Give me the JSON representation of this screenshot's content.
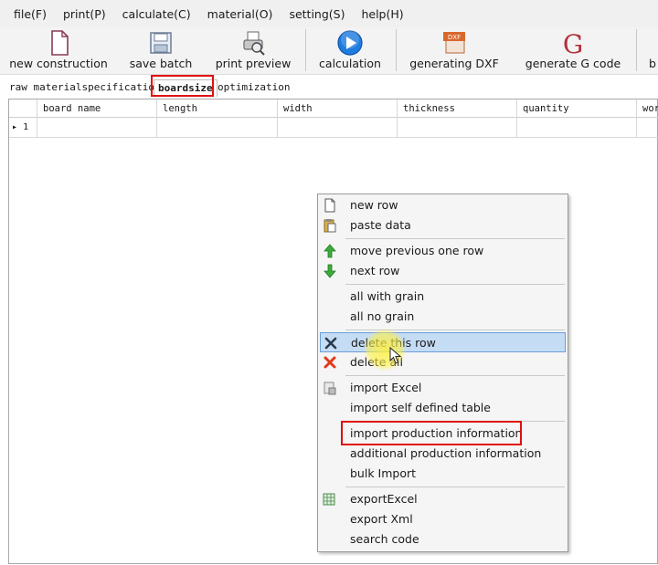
{
  "menubar": {
    "items": [
      {
        "label": "file(F)"
      },
      {
        "label": "print(P)"
      },
      {
        "label": "calculate(C)"
      },
      {
        "label": "material(O)"
      },
      {
        "label": "setting(S)"
      },
      {
        "label": "help(H)"
      }
    ]
  },
  "toolbar": {
    "items": [
      {
        "label": "new construction",
        "icon": "new-document-icon"
      },
      {
        "label": "save batch",
        "icon": "save-icon"
      },
      {
        "label": "print preview",
        "icon": "print-preview-icon"
      },
      {
        "label": "calculation",
        "icon": "play-icon"
      },
      {
        "label": "generating DXF",
        "icon": "dxf-icon",
        "badge": "DXF"
      },
      {
        "label": "generate G code",
        "icon": "g-code-icon",
        "glyph": "G"
      },
      {
        "label": "b",
        "icon": "unknown"
      }
    ]
  },
  "tabs": [
    {
      "label": "raw materialspecification",
      "active": false
    },
    {
      "label": "boardsize",
      "active": true
    },
    {
      "label": "optimization",
      "active": false
    }
  ],
  "grid": {
    "columns": [
      "board name",
      "length",
      "width",
      "thickness",
      "quantity",
      "wor"
    ],
    "rows": [
      {
        "row_number": "1",
        "cells": [
          "",
          "",
          "",
          "",
          "",
          ""
        ]
      }
    ]
  },
  "context_menu": {
    "items": [
      {
        "label": "new row",
        "icon": "new-row-icon"
      },
      {
        "label": "paste data",
        "icon": "paste-icon"
      },
      {
        "label": "move previous one row",
        "icon": "arrow-up-icon"
      },
      {
        "label": "next row",
        "icon": "arrow-down-icon"
      },
      {
        "label": "all with grain",
        "icon": ""
      },
      {
        "label": "all no grain",
        "icon": ""
      },
      {
        "label": "delete this row",
        "icon": "delete-row-icon",
        "selected": true
      },
      {
        "label": "delete all",
        "icon": "delete-all-icon"
      },
      {
        "label": "import Excel",
        "icon": "import-excel-icon"
      },
      {
        "label": "import self defined table",
        "icon": ""
      },
      {
        "label": "import production information",
        "icon": "",
        "highlighted": true
      },
      {
        "label": "additional production information",
        "icon": ""
      },
      {
        "label": "bulk Import",
        "icon": ""
      },
      {
        "label": "exportExcel",
        "icon": "export-excel-icon"
      },
      {
        "label": "export Xml",
        "icon": ""
      },
      {
        "label": "search code",
        "icon": ""
      }
    ]
  },
  "colors": {
    "highlight_border": "#e01010",
    "menu_selection": "#c5dcf5",
    "play_blue": "#1e7be0"
  }
}
